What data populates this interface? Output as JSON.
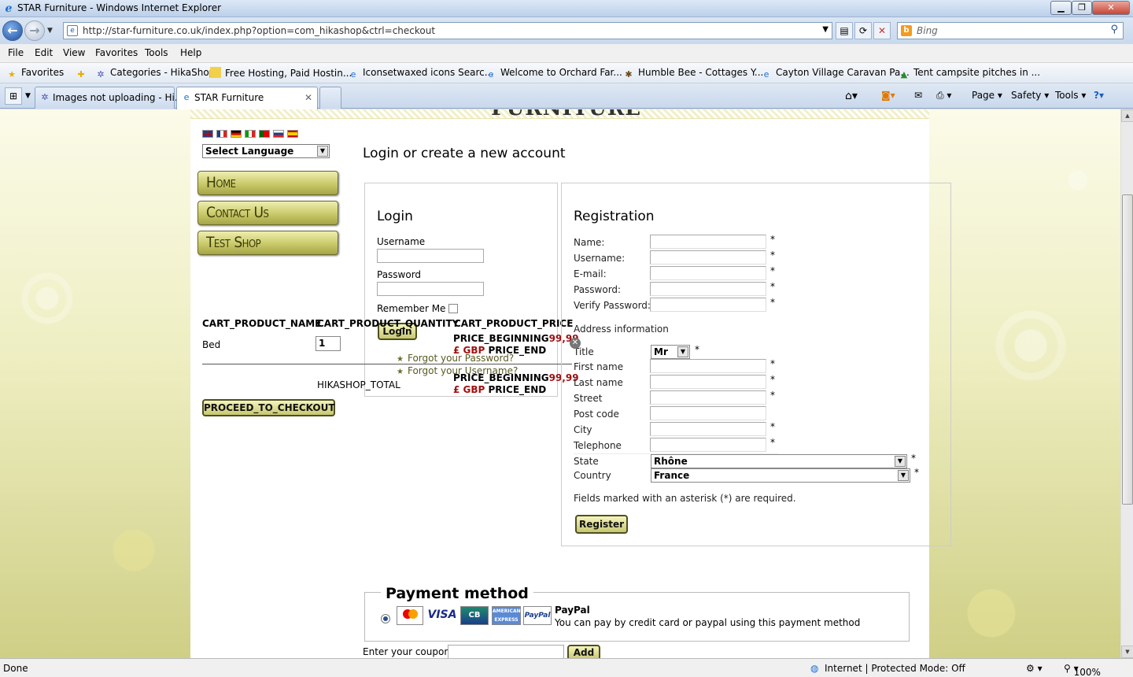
{
  "window": {
    "title": "STAR Furniture - Windows Internet Explorer",
    "controls": {
      "minimize": "▁",
      "maximize": "❐",
      "close": "✕"
    }
  },
  "address_bar": {
    "url": "http://star-furniture.co.uk/index.php?option=com_hikashop&ctrl=checkout",
    "search_placeholder": "Bing"
  },
  "menu": [
    "File",
    "Edit",
    "View",
    "Favorites",
    "Tools",
    "Help"
  ],
  "favorites_bar": {
    "label": "Favorites",
    "items": [
      "Categories - HikaShop",
      "Free Hosting, Paid Hostin...",
      "Iconsetwaxed icons  Searc...",
      "Welcome to Orchard Far...",
      "Humble Bee - Cottages Y...",
      "Cayton Village Caravan Pa...",
      "Tent campsite pitches in ..."
    ]
  },
  "tabs": [
    {
      "label": "Images not uploading - Hi...",
      "active": false
    },
    {
      "label": "STAR Furniture",
      "active": true
    }
  ],
  "command_bar": [
    "Page",
    "Safety",
    "Tools"
  ],
  "site": {
    "logo_text": "FURNITURE",
    "language_select": "Select Language",
    "nav": [
      "Home",
      "Contact Us",
      "Test Shop"
    ]
  },
  "cart": {
    "headers": [
      "CART_PRODUCT_NAME",
      "CART_PRODUCT_QUANTITY",
      "CART_PRODUCT_PRICE"
    ],
    "row": {
      "name": "Bed",
      "quantity": "1",
      "price_line1a": "PRICE_BEGINNING",
      "price_line1b": "99,99",
      "price_line2a": "£ GBP",
      "price_line2b": " PRICE_END"
    },
    "total_label": "HIKASHOP_TOTAL",
    "total": {
      "line1a": "PRICE_BEGINNING",
      "line1b": "99,99",
      "line2a": "£ GBP",
      "line2b": " PRICE_END"
    },
    "checkout_button": "PROCEED_TO_CHECKOUT"
  },
  "checkout": {
    "heading": "Login or create a new account",
    "login": {
      "title": "Login",
      "username_label": "Username",
      "password_label": "Password",
      "remember_label": "Remember Me",
      "button": "Login",
      "forgot_password": "Forgot your Password?",
      "forgot_username": "Forgot your Username?"
    },
    "registration": {
      "title": "Registration",
      "fields": [
        "Name:",
        "Username:",
        "E-mail:",
        "Password:",
        "Verify Password:"
      ],
      "address_heading": "Address information",
      "address_fields": [
        "Title",
        "First name",
        "Last name",
        "Street",
        "Post code",
        "City",
        "Telephone",
        "State",
        "Country"
      ],
      "title_value": "Mr",
      "state_value": "Rhône",
      "country_value": "France",
      "required_note": "Fields marked with an asterisk (*) are required.",
      "button": "Register",
      "asterisk": "*"
    },
    "payment": {
      "legend": "Payment method",
      "cards": [
        "MasterCard",
        "VISA",
        "CB",
        "AMERICAN EXPRESS",
        "PayPal"
      ],
      "name": "PayPal",
      "description": "You can pay by credit card or paypal using this payment method"
    },
    "coupon": {
      "label": "Enter your coupon",
      "button": "Add"
    }
  },
  "status_bar": {
    "left": "Done",
    "zone": "Internet | Protected Mode: Off",
    "zoom": "100%"
  },
  "colors": {
    "olive_button": "#c9c969",
    "price_red": "#a01010",
    "page_background": "#eeeec2"
  }
}
